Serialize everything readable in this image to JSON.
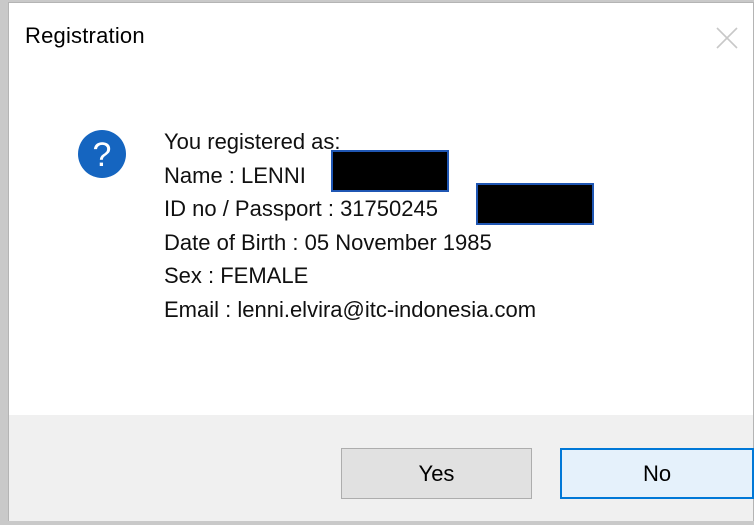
{
  "dialog": {
    "title": "Registration",
    "close_icon": "close-icon"
  },
  "message": {
    "icon": "question-icon",
    "icon_glyph": "?",
    "icon_color": "#1565c0",
    "lines": [
      "You registered as:",
      "Name : LENNI",
      "ID no / Passport : 31750245",
      "Date of Birth : 05 November 1985",
      "Sex : FEMALE",
      "Email : lenni.elvira@itc-indonesia.com"
    ]
  },
  "buttons": {
    "yes_label": "Yes",
    "no_label": "No"
  },
  "colors": {
    "accent": "#0078d7",
    "redaction": "#000000"
  }
}
